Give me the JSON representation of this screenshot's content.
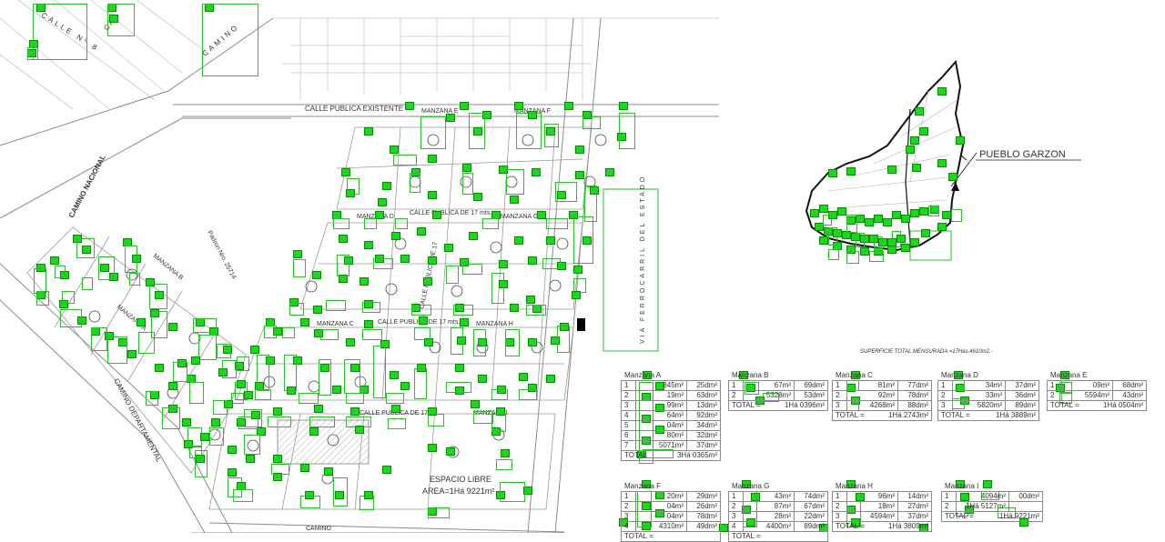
{
  "map": {
    "streets": {
      "existing": "CALLE PUBLICA EXISTENTE",
      "ancho17_a": "CALLE PUBLICA DE 17 mts.",
      "ancho17_b": "CALLE PUBLICA DE 17 mts.",
      "ancho17_c": "CALLE PUBLICA DE 17 m",
      "vertical": "CALLE PUBLICA DE 17",
      "nacional": "CAMINO NACIONAL",
      "departamental": "CAMINO DEPARTAMENTAL",
      "camino_top": "CAMINO",
      "camino_bottom": "CAMINO",
      "calle8": "CALLE Nº 8",
      "calle_c": "C A L"
    },
    "railway": "VIA FERROCARRIL DEL ESTADO",
    "padron": "Padron Nro. 25714",
    "blocks": [
      "MANZANA A",
      "MANZANA B",
      "MANZANA C",
      "MANZANA D",
      "MANZANA E",
      "MANZANA F",
      "MANZANA G",
      "MANZANA H",
      "MANZANA I"
    ],
    "open_space": {
      "label": "ESPACIO LIBRE",
      "area": "AREA=1Há 9221m²"
    }
  },
  "location": {
    "town": "PUEBLO GARZON"
  },
  "summary": {
    "total": "SUPERFICIE TOTAL MENSURADA =17Has.4610m2.-"
  },
  "tables": [
    {
      "title": "Manzana A",
      "rows": [
        {
          "lot": "1",
          "area": "845m²",
          "dm": "25dm²"
        },
        {
          "lot": "2",
          "area": "19m²",
          "dm": "63dm²"
        },
        {
          "lot": "3",
          "area": "99m²",
          "dm": "13dm²"
        },
        {
          "lot": "4",
          "area": "64m²",
          "dm": "92dm²"
        },
        {
          "lot": "5",
          "area": "04m²",
          "dm": "34dm²"
        },
        {
          "lot": "6",
          "area": "80m²",
          "dm": "32dm²"
        },
        {
          "lot": "7",
          "area": "5071m²",
          "dm": "37dm²"
        }
      ],
      "total_label": "TOTAL",
      "total_value": "3Há 0365m²"
    },
    {
      "title": "Manzana B",
      "rows": [
        {
          "lot": "1",
          "area": "67m²",
          "dm": "69dm²"
        },
        {
          "lot": "2",
          "area": "5328m²",
          "dm": "53dm²"
        }
      ],
      "total_label": "TOTAL =",
      "total_value": "1Há 0396m²"
    },
    {
      "title": "Manzana C",
      "rows": [
        {
          "lot": "1",
          "area": "81m²",
          "dm": "77dm²"
        },
        {
          "lot": "2",
          "area": "92m²",
          "dm": "78dm²"
        },
        {
          "lot": "3",
          "area": "4268m²",
          "dm": "88dm²"
        }
      ],
      "total_label": "TOTAL =",
      "total_value": "1Há 2743m²"
    },
    {
      "title": "Manzana D",
      "rows": [
        {
          "lot": "1",
          "area": "34m²",
          "dm": "37dm²"
        },
        {
          "lot": "2",
          "area": "33m²",
          "dm": "36dm²"
        },
        {
          "lot": "3",
          "area": "5820m²",
          "dm": "89dm²"
        }
      ],
      "total_label": "TOTAL =",
      "total_value": "1Há 3889m²"
    },
    {
      "title": "Manzana E",
      "rows": [
        {
          "lot": "1",
          "area": "09m²",
          "dm": "68dm²"
        },
        {
          "lot": "2",
          "area": "5594m²",
          "dm": "43dm²"
        }
      ],
      "total_label": "TOTAL =",
      "total_value": "1Há 0504m²"
    },
    {
      "title": "Manzana F",
      "rows": [
        {
          "lot": "1",
          "area": "20m²",
          "dm": "29dm²"
        },
        {
          "lot": "2",
          "area": "04m²",
          "dm": "26dm²"
        },
        {
          "lot": "3",
          "area": "04m²",
          "dm": "78dm²"
        },
        {
          "lot": "4",
          "area": "4310m²",
          "dm": "49dm²"
        }
      ],
      "total_label": "TOTAL =",
      "total_value": ""
    },
    {
      "title": "Manzana G",
      "rows": [
        {
          "lot": "1",
          "area": "43m²",
          "dm": "74dm²"
        },
        {
          "lot": "2",
          "area": "87m²",
          "dm": "67dm²"
        },
        {
          "lot": "3",
          "area": "28m²",
          "dm": "22dm²"
        },
        {
          "lot": "4",
          "area": "4400m²",
          "dm": "89dm²"
        }
      ],
      "total_label": "TOTAL =",
      "total_value": ""
    },
    {
      "title": "Manzana H",
      "rows": [
        {
          "lot": "1",
          "area": "96m²",
          "dm": "14dm²"
        },
        {
          "lot": "2",
          "area": "18m²",
          "dm": "27dm²"
        },
        {
          "lot": "3",
          "area": "4594m²",
          "dm": "37dm²"
        }
      ],
      "total_label": "TOTAL =",
      "total_value": "1Há 3809m²"
    },
    {
      "title": "Manzana I",
      "rows": [
        {
          "lot": "1",
          "area": "4094m²",
          "dm": "00dm²"
        },
        {
          "lot": "2",
          "area": "1Há 5127m²",
          "dm": ""
        }
      ],
      "total_label": "TOTAL =",
      "total_value": "1Há 9221m²"
    }
  ],
  "colors": {
    "overlay": "#1bd81b",
    "box": "#27c127",
    "line": "#8c8c8c"
  }
}
